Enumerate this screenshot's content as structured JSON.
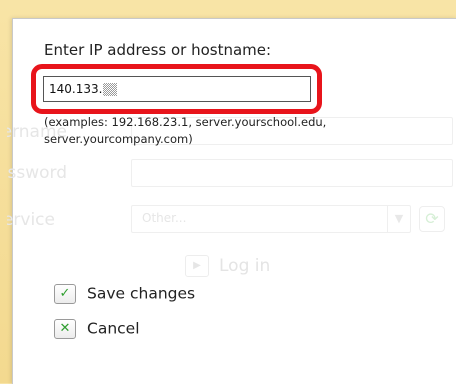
{
  "background_form": {
    "username_label": "Username:",
    "password_label": "Password:",
    "service_label": "Service:",
    "service_value": "Other...",
    "login_label": "Log in"
  },
  "dialog": {
    "prompt": "Enter IP address or hostname:",
    "input_value": "140.133.",
    "examples_line1": "(examples: 192.168.23.1, server.yourschool.edu,",
    "examples_line2": "server.yourcompany.com)",
    "save_label": "Save changes",
    "cancel_label": "Cancel"
  },
  "icons": {
    "save": "check-icon",
    "cancel": "x-icon"
  },
  "colors": {
    "highlight": "#e8141b",
    "icon_green": "#2f9e2f",
    "backdrop": "#f3d98f"
  }
}
